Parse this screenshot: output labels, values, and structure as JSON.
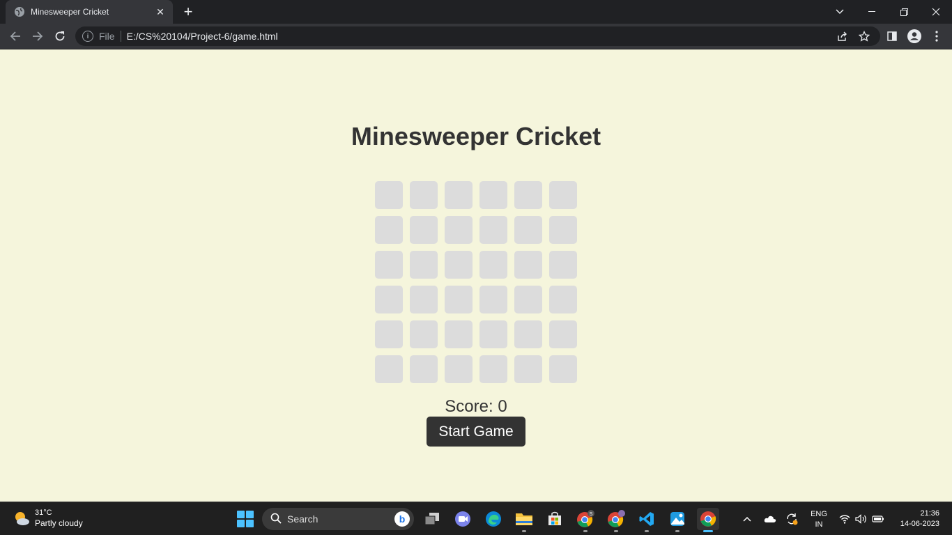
{
  "browser": {
    "tab_title": "Minesweeper Cricket",
    "url_scheme": "File",
    "url": "E:/CS%20104/Project-6/game.html"
  },
  "game": {
    "title": "Minesweeper Cricket",
    "rows": 6,
    "cols": 6,
    "score_label": "Score: 0",
    "start_button_label": "Start Game",
    "colors": {
      "background": "#f5f5dc",
      "cell": "#dcdcdc",
      "button": "#333333",
      "text": "#333333"
    }
  },
  "taskbar": {
    "weather_temp": "31°C",
    "weather_desc": "Partly cloudy",
    "search_placeholder": "Search",
    "lang_line1": "ENG",
    "lang_line2": "IN",
    "time": "21:36",
    "date": "14-06-2023",
    "apps": [
      "task-view-icon",
      "meet-icon",
      "edge-icon",
      "file-explorer-icon",
      "store-icon",
      "chrome-profile-s-icon",
      "chrome-profile-2-icon",
      "vscode-icon",
      "photos-icon",
      "chrome-icon"
    ]
  }
}
